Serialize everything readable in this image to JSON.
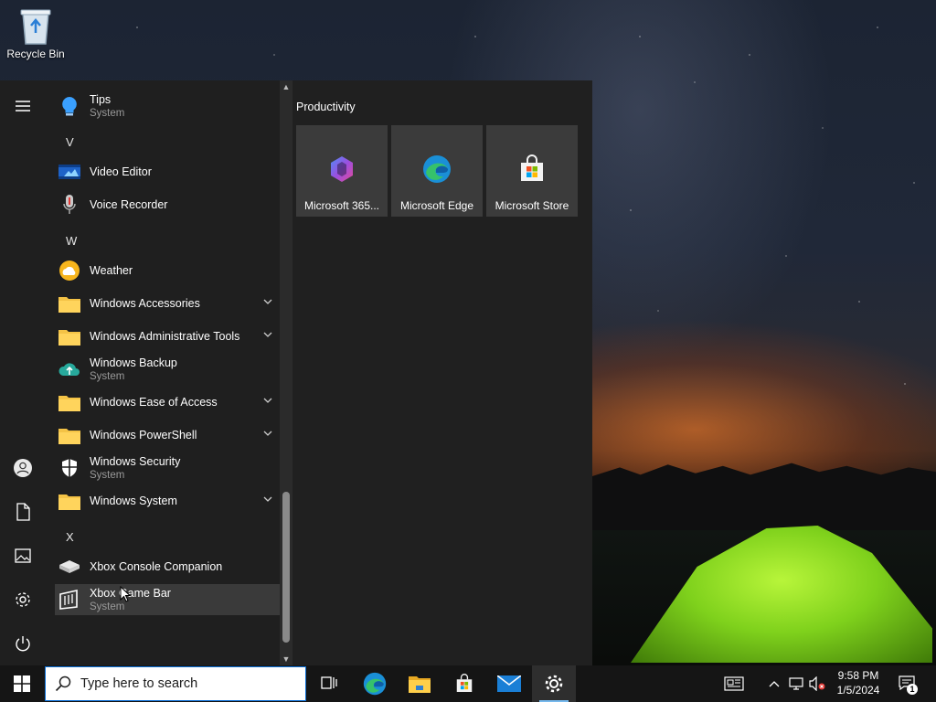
{
  "desktop": {
    "icons": [
      {
        "label": "Recycle Bin",
        "icon": "recycle-bin-icon"
      }
    ]
  },
  "start_menu": {
    "rail": [
      {
        "name": "menu-icon"
      },
      {
        "name": "user-account-icon"
      },
      {
        "name": "documents-icon"
      },
      {
        "name": "pictures-icon"
      },
      {
        "name": "settings-icon"
      },
      {
        "name": "power-icon"
      }
    ],
    "app_list": [
      {
        "type": "app",
        "name": "Tips",
        "sub": "System",
        "icon": "tips-icon"
      },
      {
        "type": "letter",
        "name": "V"
      },
      {
        "type": "app",
        "name": "Video Editor",
        "icon": "video-editor-icon"
      },
      {
        "type": "app",
        "name": "Voice Recorder",
        "icon": "voice-recorder-icon"
      },
      {
        "type": "letter",
        "name": "W"
      },
      {
        "type": "app",
        "name": "Weather",
        "icon": "weather-icon"
      },
      {
        "type": "folder",
        "name": "Windows Accessories",
        "icon": "folder-icon"
      },
      {
        "type": "folder",
        "name": "Windows Administrative Tools",
        "icon": "folder-icon"
      },
      {
        "type": "app",
        "name": "Windows Backup",
        "sub": "System",
        "icon": "backup-icon"
      },
      {
        "type": "folder",
        "name": "Windows Ease of Access",
        "icon": "folder-icon"
      },
      {
        "type": "folder",
        "name": "Windows PowerShell",
        "icon": "folder-icon"
      },
      {
        "type": "app",
        "name": "Windows Security",
        "sub": "System",
        "icon": "shield-icon"
      },
      {
        "type": "folder",
        "name": "Windows System",
        "icon": "folder-icon"
      },
      {
        "type": "letter",
        "name": "X"
      },
      {
        "type": "app",
        "name": "Xbox Console Companion",
        "icon": "xbox-console-icon"
      },
      {
        "type": "app",
        "name": "Xbox Game Bar",
        "sub": "System",
        "icon": "xbox-game-bar-icon",
        "hovered": true
      }
    ],
    "tile_group": {
      "title": "Productivity",
      "tiles": [
        {
          "label": "Microsoft 365...",
          "icon": "microsoft-365-icon"
        },
        {
          "label": "Microsoft Edge",
          "icon": "edge-icon"
        },
        {
          "label": "Microsoft Store",
          "icon": "store-icon"
        }
      ]
    }
  },
  "taskbar": {
    "search_placeholder": "Type here to search",
    "pinned": [
      {
        "name": "task-view-icon"
      },
      {
        "name": "edge-icon"
      },
      {
        "name": "file-explorer-icon"
      },
      {
        "name": "store-icon"
      },
      {
        "name": "mail-icon"
      },
      {
        "name": "settings-icon",
        "active": true
      }
    ],
    "tray": {
      "icons": [
        "news-icon",
        "chevron-up-icon",
        "network-icon",
        "volume-muted-icon"
      ],
      "time": "9:58 PM",
      "date": "1/5/2024",
      "notification_count": "1"
    }
  },
  "colors": {
    "start_bg": "#1f1f1f",
    "tile_bg": "#3b3b3b",
    "taskbar_bg": "#151515",
    "accent": "#76b9ed",
    "search_border": "#0a6fd8"
  }
}
